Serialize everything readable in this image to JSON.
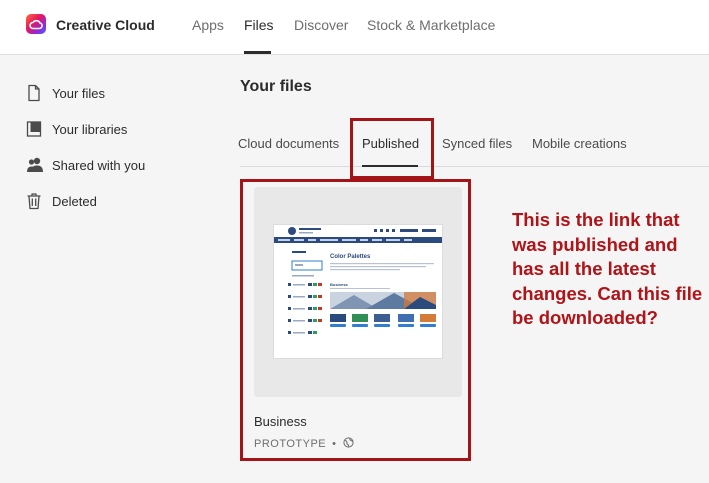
{
  "header": {
    "brand": "Creative Cloud",
    "nav": [
      {
        "label": "Apps"
      },
      {
        "label": "Files"
      },
      {
        "label": "Discover"
      },
      {
        "label": "Stock & Marketplace"
      }
    ],
    "active_nav": "Files"
  },
  "sidebar": {
    "items": [
      {
        "label": "Your files",
        "icon": "file-icon"
      },
      {
        "label": "Your libraries",
        "icon": "library-icon"
      },
      {
        "label": "Shared with you",
        "icon": "people-icon"
      },
      {
        "label": "Deleted",
        "icon": "trash-icon"
      }
    ]
  },
  "main": {
    "title": "Your files",
    "tabs": [
      {
        "label": "Cloud documents"
      },
      {
        "label": "Published"
      },
      {
        "label": "Synced files"
      },
      {
        "label": "Mobile creations"
      }
    ],
    "active_tab": "Published",
    "card": {
      "name": "Business",
      "type": "PROTOTYPE",
      "separator": "•",
      "visibility_icon": "globe-icon",
      "preview": {
        "heading": "Color Palettes",
        "section": "Business"
      }
    }
  },
  "annotation": {
    "text": "This is the link that was published and has all the latest changes. Can this file be downloaded?",
    "color": "#b01318"
  },
  "colors": {
    "highlight_border": "#a31419",
    "preview_navy": "#2b4a7e",
    "preview_accent": "#2f7fd0"
  }
}
